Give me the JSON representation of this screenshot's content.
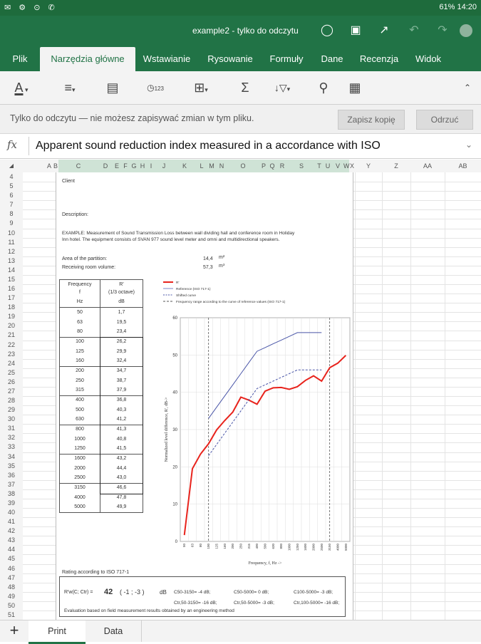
{
  "status_bar": {
    "left_icons": "✉ ⚙ ⊙ ✆",
    "right": "61% 14:20"
  },
  "title_bar": {
    "title": "example2 - tylko do odczytu"
  },
  "ribbon_tabs": [
    "Plik",
    "Narzędzia główne",
    "Wstawianie",
    "Rysowanie",
    "Formuły",
    "Dane",
    "Recenzja",
    "Widok"
  ],
  "readonly_bar": {
    "message": "Tylko do odczytu — nie możesz zapisywać zmian w tym pliku.",
    "save_copy": "Zapisz kopię",
    "dismiss": "Odrzuć"
  },
  "formula_bar": {
    "fx": "fx",
    "value": "Apparent sound reduction index measured in a accordance with ISO"
  },
  "column_headers": [
    "A",
    "B",
    "C",
    "D",
    "E",
    "F",
    "G",
    "H",
    "I",
    "J",
    "K",
    "L",
    "M",
    "N",
    "O",
    "P",
    "Q",
    "R",
    "S",
    "T",
    "U",
    "V",
    "W",
    "X",
    "Y",
    "Z",
    "AA",
    "AB"
  ],
  "row_headers": [
    "4",
    "5",
    "6",
    "7",
    "8",
    "9",
    "10",
    "11",
    "12",
    "13",
    "14",
    "15",
    "16",
    "17",
    "18",
    "19",
    "20",
    "21",
    "22",
    "23",
    "24",
    "25",
    "26",
    "27",
    "28",
    "29",
    "30",
    "31",
    "32",
    "33",
    "34",
    "35",
    "36",
    "37",
    "38",
    "39",
    "40",
    "41",
    "42",
    "43",
    "44",
    "45",
    "46",
    "47",
    "48",
    "49",
    "50",
    "51"
  ],
  "sheet": {
    "client": "Client",
    "description": "Description:",
    "example_line1": "EXAMPLE: Measurement of Sound Transmission Loss between wall dividing hall and conference room in Holiday",
    "example_line2": "Inn hotel. The equipment consists of SVAN 977 sound level meter and omni and multidirectional speakers.",
    "area_label": "Area of the partition:",
    "area_value": "14,4",
    "area_unit": "m²",
    "volume_label": "Receiving room volume:",
    "volume_value": "57,3",
    "volume_unit": "m³",
    "table_header": {
      "col1_line1": "Frequency",
      "col1_line2": "f",
      "col1_line3": "Hz",
      "col2_line1": "R'",
      "col2_line2": "(1/3 octave)",
      "col2_line3": "dB"
    },
    "table_rows": [
      [
        "50",
        "1,7"
      ],
      [
        "63",
        "19,5"
      ],
      [
        "80",
        "23,4"
      ],
      [
        "100",
        "26,2"
      ],
      [
        "125",
        "29,9"
      ],
      [
        "160",
        "32,4"
      ],
      [
        "200",
        "34,7"
      ],
      [
        "250",
        "38,7"
      ],
      [
        "315",
        "37,9"
      ],
      [
        "400",
        "36,8"
      ],
      [
        "500",
        "40,3"
      ],
      [
        "630",
        "41,2"
      ],
      [
        "800",
        "41,3"
      ],
      [
        "1000",
        "40,8"
      ],
      [
        "1250",
        "41,5"
      ],
      [
        "1600",
        "43,2"
      ],
      [
        "2000",
        "44,4"
      ],
      [
        "2500",
        "43,0"
      ],
      [
        "3150",
        "46,6"
      ],
      [
        "4000",
        "47,8"
      ],
      [
        "5000",
        "49,9"
      ]
    ],
    "legend": [
      "R'",
      "Reference (ISO 717-1)",
      "Shifted curve",
      "Frequency range according to the curve of reference values (ISO 717-1)"
    ],
    "rating_title": "Rating according to ISO 717-1",
    "rating_formula": "R'w(C; Ctr) =",
    "rating_value": "42",
    "rating_c": "( -1 ; -3 )",
    "rating_unit": "dB",
    "c_terms": [
      "C50-3150= -4 dB;",
      "C50-5000= 0 dB;",
      "C100-5000= -3 dB;",
      "Ctr,50-3150= -16 dB;",
      "Ctr,50-5000= -3 dB;",
      "Ctr,100-5000= -16 dB;"
    ],
    "footer": "Evaluation based on field measurement results obtained by an engineering method"
  },
  "chart_data": {
    "type": "line",
    "ylabel": "Normalized level difference, R', dB->",
    "xlabel": "Frequency, f, Hz ->",
    "ylim": [
      0,
      60
    ],
    "yticks": [
      0,
      10,
      20,
      30,
      40,
      50,
      60
    ],
    "x": [
      "50",
      "63",
      "80",
      "100",
      "125",
      "160",
      "200",
      "250",
      "315",
      "400",
      "500",
      "630",
      "800",
      "1000",
      "1250",
      "1600",
      "2000",
      "2500",
      "3150",
      "4000",
      "5000"
    ],
    "series": [
      {
        "name": "R'",
        "color": "#e8231c",
        "values": [
          1.7,
          19.5,
          23.4,
          26.2,
          29.9,
          32.4,
          34.7,
          38.7,
          37.9,
          36.8,
          40.3,
          41.2,
          41.3,
          40.8,
          41.5,
          43.2,
          44.4,
          43.0,
          46.6,
          47.8,
          49.9
        ]
      },
      {
        "name": "Reference (ISO 717-1)",
        "color": "#4a56a8",
        "values": [
          null,
          null,
          null,
          33,
          36,
          39,
          42,
          45,
          48,
          51,
          52,
          53,
          54,
          55,
          56,
          56,
          56,
          56,
          null,
          null,
          null
        ]
      },
      {
        "name": "Shifted curve",
        "color": "#4a56a8",
        "values": [
          null,
          null,
          null,
          23,
          26,
          29,
          32,
          35,
          38,
          41,
          42,
          43,
          44,
          45,
          46,
          46,
          46,
          46,
          null,
          null,
          null
        ]
      }
    ],
    "range_markers": [
      "100",
      "3150"
    ],
    "grid": true
  },
  "sheet_tabs": [
    "Print",
    "Data"
  ]
}
